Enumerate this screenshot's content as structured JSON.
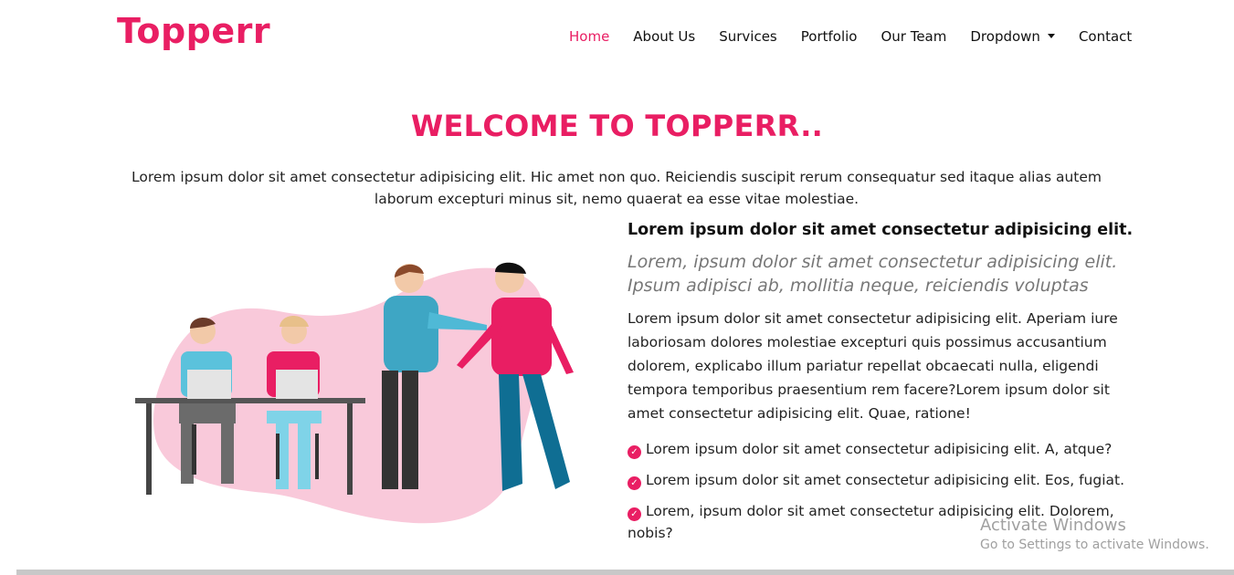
{
  "brand": "Topperr",
  "nav": {
    "items": [
      {
        "label": "Home",
        "active": true
      },
      {
        "label": "About Us"
      },
      {
        "label": "Survices"
      },
      {
        "label": "Portfolio"
      },
      {
        "label": "Our Team"
      },
      {
        "label": "Dropdown"
      },
      {
        "label": "Contact"
      }
    ]
  },
  "hero": {
    "title": "WELCOME TO TOPPERR..",
    "intro": "Lorem ipsum dolor sit amet consectetur adipisicing elit. Hic amet non quo. Reiciendis suscipit rerum consequatur sed itaque alias autem laborum excepturi minus sit, nemo quaerat ea esse vitae molestiae."
  },
  "about": {
    "heading": "Lorem ipsum dolor sit amet consectetur adipisicing elit.",
    "lead": "Lorem, ipsum dolor sit amet consectetur adipisicing elit. Ipsum adipisci ab, mollitia neque, reiciendis voluptas",
    "body": "Lorem ipsum dolor sit amet consectetur adipisicing elit. Aperiam iure laboriosam dolores molestiae excepturi quis possimus accusantium dolorem, explicabo illum pariatur repellat obcaecati nulla, eligendi tempora temporibus praesentium rem facere?Lorem ipsum dolor sit amet consectetur adipisicing elit. Quae, ratione!",
    "checks": [
      "Lorem ipsum dolor sit amet consectetur adipisicing elit. A, atque?",
      "Lorem ipsum dolor sit amet consectetur adipisicing elit. Eos, fugiat.",
      "Lorem, ipsum dolor sit amet consectetur adipisicing elit. Dolorem, nobis?"
    ],
    "check_icon": "check-circle-icon"
  },
  "watermark": {
    "line1": "Activate Windows",
    "line2": "Go to Settings to activate Windows."
  },
  "colors": {
    "accent": "#e91e63",
    "blob": "#f9c9da",
    "teal": "#4fb9d6",
    "navy": "#0f6e93"
  }
}
